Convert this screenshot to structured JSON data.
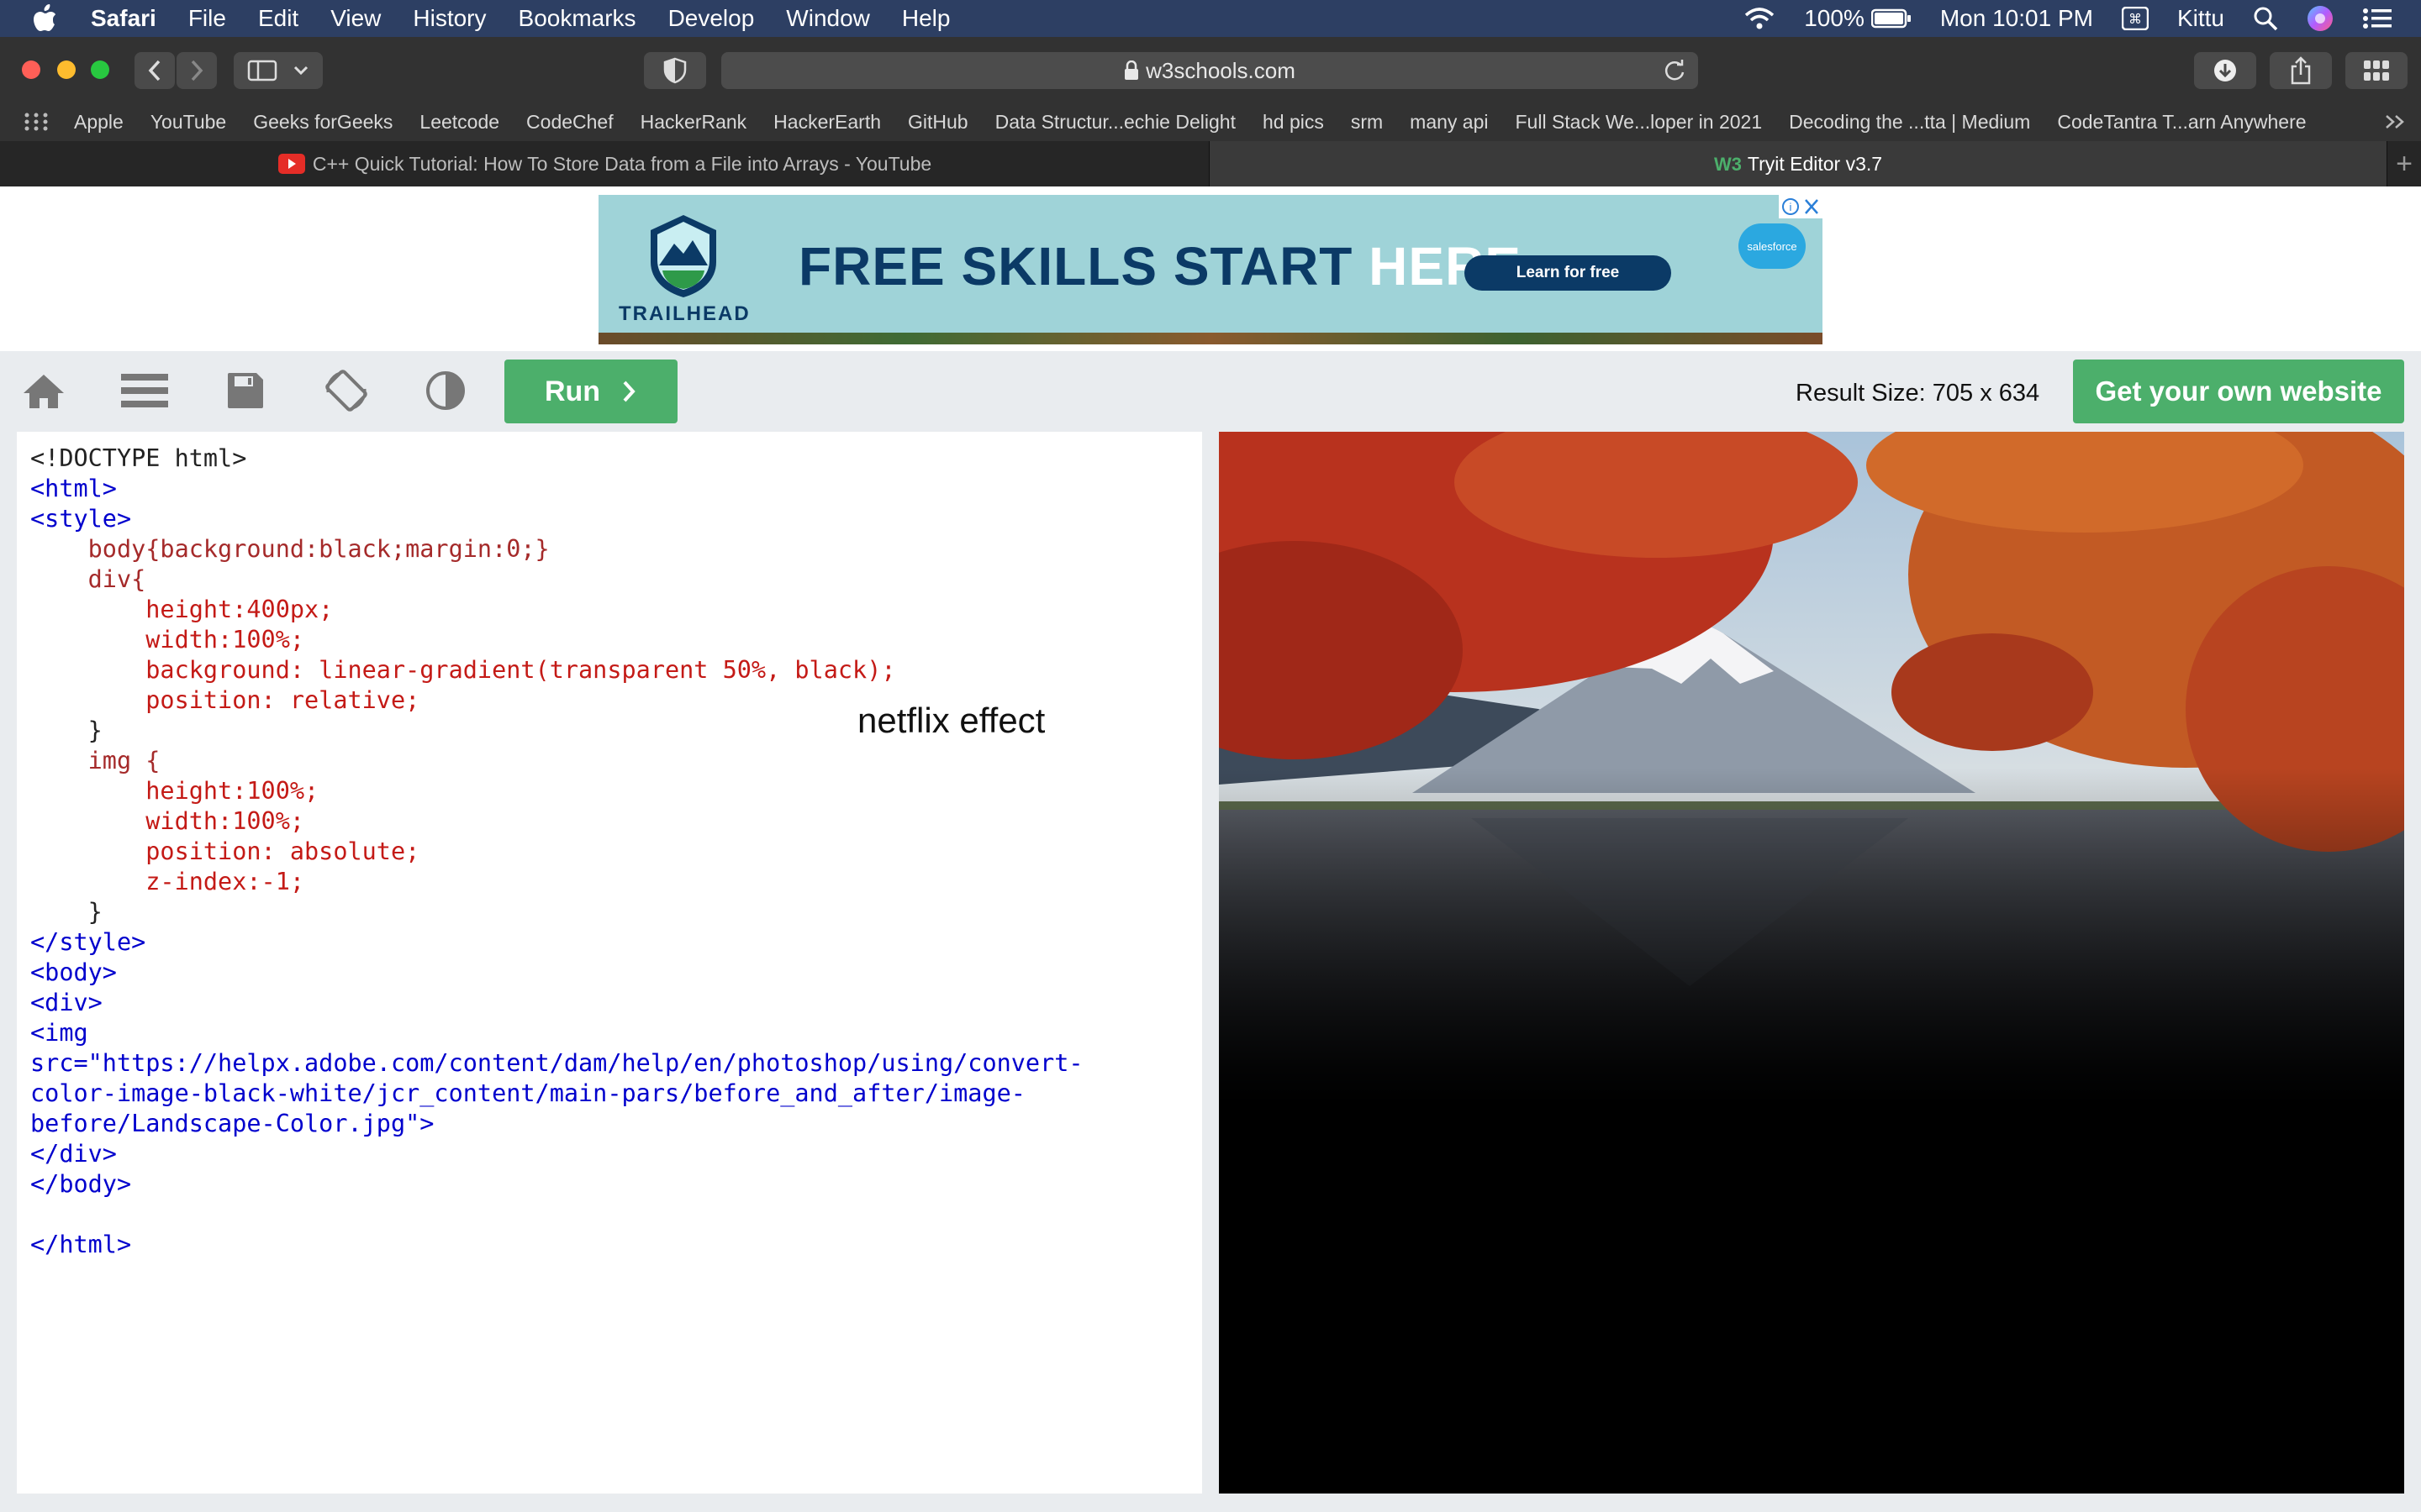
{
  "menubar": {
    "app": "Safari",
    "items": [
      "File",
      "Edit",
      "View",
      "History",
      "Bookmarks",
      "Develop",
      "Window",
      "Help"
    ],
    "battery": "100%",
    "clock": "Mon 10:01 PM",
    "user": "Kittu"
  },
  "address": {
    "url": "w3schools.com"
  },
  "bookmarks": [
    "Apple",
    "YouTube",
    "Geeks forGeeks",
    "Leetcode",
    "CodeChef",
    "HackerRank",
    "HackerEarth",
    "GitHub",
    "Data Structur...echie Delight",
    "hd pics",
    "srm",
    "many api",
    "Full Stack We...loper in 2021",
    "Decoding the ...tta | Medium",
    "CodeTantra T...arn Anywhere"
  ],
  "tabs": [
    {
      "label": "C++ Quick Tutorial: How To Store Data from a File into Arrays - YouTube",
      "active": false
    },
    {
      "label": "Tryit Editor v3.7",
      "active": true
    }
  ],
  "ad": {
    "headline_a": "FREE SKILLS START ",
    "headline_b": "HERE.",
    "cta": "Learn for free",
    "brand": "TRAILHEAD",
    "partner": "salesforce"
  },
  "w3toolbar": {
    "run_label": "Run",
    "result_size": "Result Size: 705 x 634",
    "get_website": "Get your own website"
  },
  "editor": {
    "lines": [
      "<!DOCTYPE html>",
      "<html>",
      "<style>",
      "    body{background:black;margin:0;}",
      "    div{",
      "        height:400px;",
      "        width:100%;",
      "        background: linear-gradient(transparent 50%, black);",
      "        position: relative;",
      "    }",
      "    img {",
      "        height:100%;",
      "        width:100%;",
      "        position: absolute;",
      "        z-index:-1;",
      "    }",
      "</style>",
      "<body>",
      "<div>",
      "<img",
      "src=\"https://helpx.adobe.com/content/dam/help/en/photoshop/using/convert-",
      "color-image-black-white/jcr_content/main-pars/before_and_after/image-",
      "before/Landscape-Color.jpg\">",
      "</div>",
      "</body>",
      "",
      "</html>"
    ],
    "annotation": "netflix effect"
  },
  "colors": {
    "menubar_bg": "#2d3f63",
    "run_green": "#4caf6b",
    "tag_blue": "#0000cd",
    "prop_red": "#c41a16"
  }
}
